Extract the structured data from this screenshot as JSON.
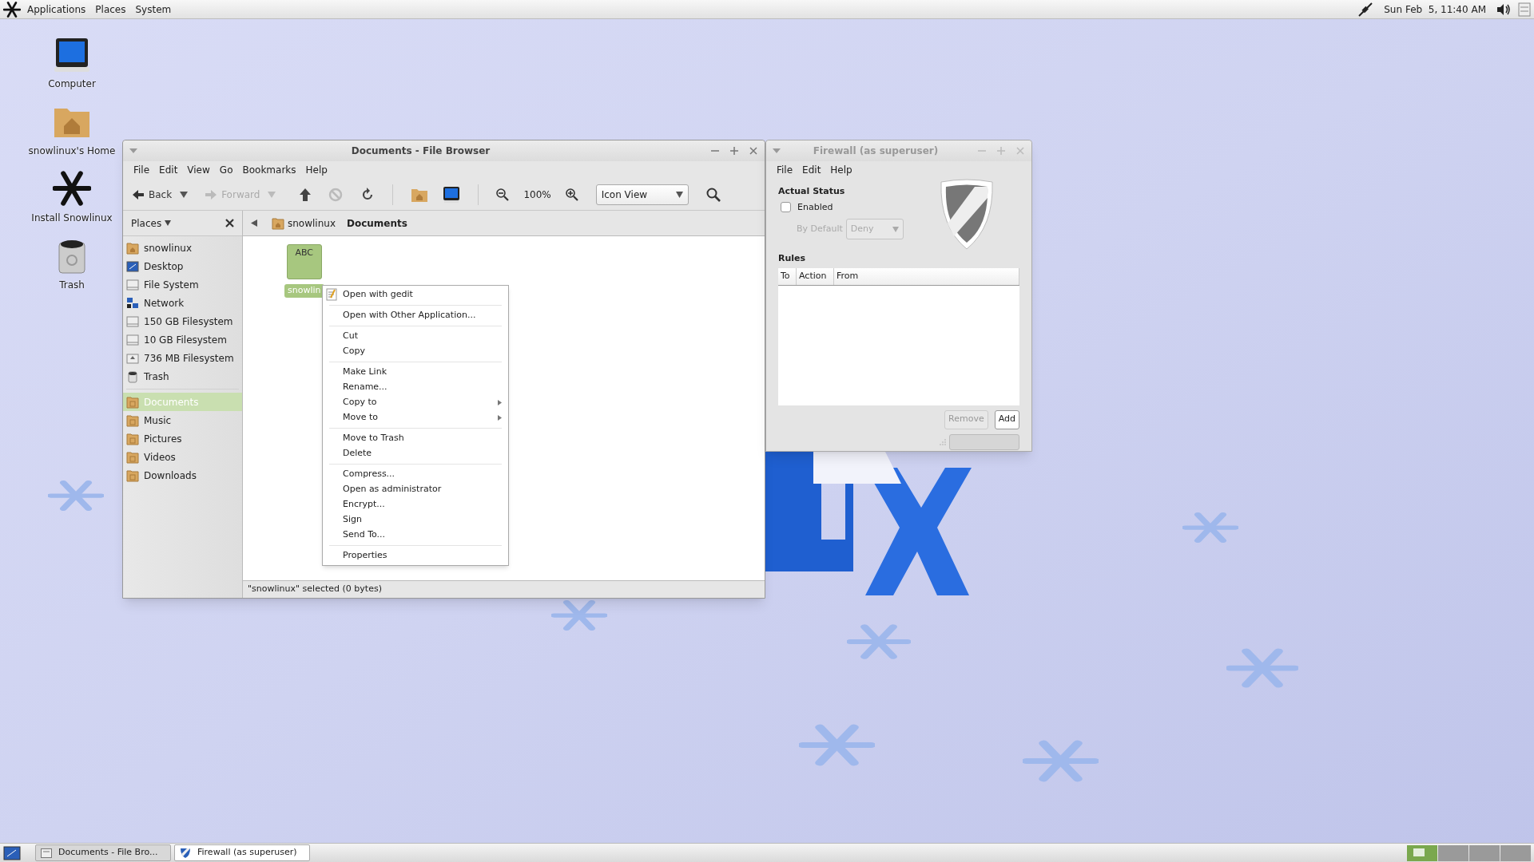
{
  "top_panel": {
    "menus": [
      "Applications",
      "Places",
      "System"
    ],
    "clock": "Sun Feb  5, 11:40 AM"
  },
  "desktop_icons": [
    {
      "label": "Computer",
      "kind": "computer"
    },
    {
      "label": "snowlinux's Home",
      "kind": "home"
    },
    {
      "label": "Install Snowlinux",
      "kind": "snowflake"
    },
    {
      "label": "Trash",
      "kind": "trash"
    }
  ],
  "file_browser": {
    "title": "Documents - File Browser",
    "active": true,
    "menu": [
      "File",
      "Edit",
      "View",
      "Go",
      "Bookmarks",
      "Help"
    ],
    "toolbar": {
      "back": "Back",
      "forward": "Forward",
      "zoom": "100%",
      "view": "Icon View"
    },
    "sidebar": {
      "header": "Places",
      "groups": [
        [
          {
            "label": "snowlinux",
            "kind": "home",
            "selected": false
          },
          {
            "label": "Desktop",
            "kind": "desktop",
            "selected": false
          },
          {
            "label": "File System",
            "kind": "drive",
            "selected": false
          },
          {
            "label": "Network",
            "kind": "network",
            "selected": false
          },
          {
            "label": "150 GB Filesystem",
            "kind": "drive",
            "selected": false
          },
          {
            "label": "10 GB Filesystem",
            "kind": "drive",
            "selected": false
          },
          {
            "label": "736 MB Filesystem",
            "kind": "optical",
            "selected": false
          },
          {
            "label": "Trash",
            "kind": "trash",
            "selected": false
          }
        ],
        [
          {
            "label": "Documents",
            "kind": "folder",
            "selected": true
          },
          {
            "label": "Music",
            "kind": "folder",
            "selected": false
          },
          {
            "label": "Pictures",
            "kind": "folder",
            "selected": false
          },
          {
            "label": "Videos",
            "kind": "folder",
            "selected": false
          },
          {
            "label": "Downloads",
            "kind": "folder",
            "selected": false
          }
        ]
      ]
    },
    "breadcrumb": [
      {
        "label": "snowlinux",
        "selected": false
      },
      {
        "label": "Documents",
        "selected": true
      }
    ],
    "files": [
      {
        "label": "snowlin",
        "thumb": "ABC",
        "selected": true
      }
    ],
    "status": "\"snowlinux\" selected (0 bytes)"
  },
  "context_menu": [
    [
      {
        "label": "Open with gedit",
        "submenu": false,
        "icon": true
      }
    ],
    [
      {
        "label": "Open with Other Application...",
        "submenu": false,
        "icon": false
      }
    ],
    [
      {
        "label": "Cut",
        "submenu": false,
        "icon": false
      },
      {
        "label": "Copy",
        "submenu": false,
        "icon": false
      }
    ],
    [
      {
        "label": "Make Link",
        "submenu": false,
        "icon": false
      },
      {
        "label": "Rename...",
        "submenu": false,
        "icon": false
      },
      {
        "label": "Copy to",
        "submenu": true,
        "icon": false
      },
      {
        "label": "Move to",
        "submenu": true,
        "icon": false
      }
    ],
    [
      {
        "label": "Move to Trash",
        "submenu": false,
        "icon": false
      },
      {
        "label": "Delete",
        "submenu": false,
        "icon": false
      }
    ],
    [
      {
        "label": "Compress...",
        "submenu": false,
        "icon": false
      },
      {
        "label": "Open as administrator",
        "submenu": false,
        "icon": false
      },
      {
        "label": "Encrypt...",
        "submenu": false,
        "icon": false
      },
      {
        "label": "Sign",
        "submenu": false,
        "icon": false
      },
      {
        "label": "Send To...",
        "submenu": false,
        "icon": false
      }
    ],
    [
      {
        "label": "Properties",
        "submenu": false,
        "icon": false
      }
    ]
  ],
  "firewall": {
    "title": "Firewall (as superuser)",
    "active": false,
    "menu": [
      "File",
      "Edit",
      "Help"
    ],
    "status_heading": "Actual Status",
    "enabled": {
      "label": "Enabled",
      "checked": false
    },
    "default": {
      "label": "By Default",
      "value": "Deny",
      "disabled": true
    },
    "rules_heading": "Rules",
    "columns": [
      "To",
      "Action",
      "From"
    ],
    "buttons": [
      {
        "label": "Remove",
        "disabled": true
      },
      {
        "label": "Add",
        "disabled": false
      }
    ]
  },
  "taskbar": {
    "tasks": [
      {
        "label": "Documents - File Bro...",
        "selected": false
      },
      {
        "label": "Firewall (as superuser)",
        "selected": true
      }
    ],
    "workspaces": [
      {
        "selected": true
      },
      {
        "selected": false
      },
      {
        "selected": false
      },
      {
        "selected": false
      }
    ]
  }
}
